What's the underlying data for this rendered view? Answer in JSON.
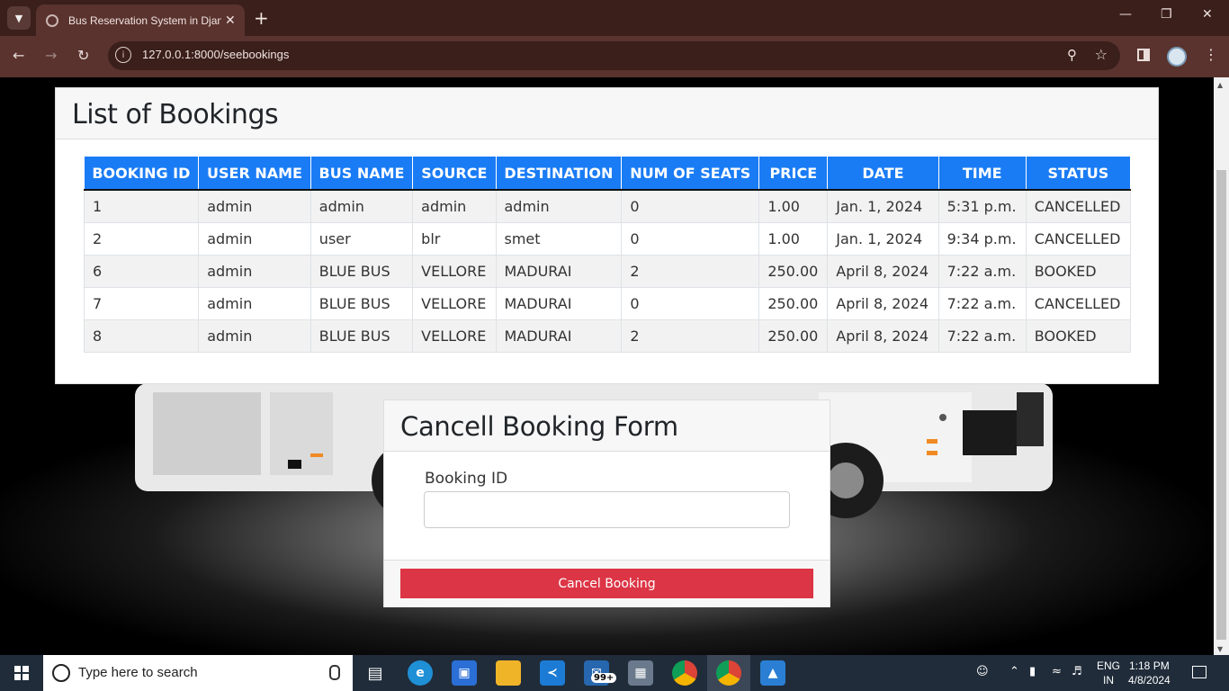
{
  "browser": {
    "tab_title": "Bus Reservation System in Django",
    "url": "127.0.0.1:8000/seebookings",
    "tab_list_icon": "chevron-down-icon",
    "new_tab_icon": "plus-icon"
  },
  "bookings": {
    "title": "List of Bookings",
    "columns": [
      "BOOKING ID",
      "USER NAME",
      "BUS NAME",
      "SOURCE",
      "DESTINATION",
      "NUM OF SEATS",
      "PRICE",
      "DATE",
      "TIME",
      "STATUS"
    ],
    "rows": [
      [
        "1",
        "admin",
        "admin",
        "admin",
        "admin",
        "0",
        "1.00",
        "Jan. 1, 2024",
        "5:31 p.m.",
        "CANCELLED"
      ],
      [
        "2",
        "admin",
        "user",
        "blr",
        "smet",
        "0",
        "1.00",
        "Jan. 1, 2024",
        "9:34 p.m.",
        "CANCELLED"
      ],
      [
        "6",
        "admin",
        "BLUE BUS",
        "VELLORE",
        "MADURAI",
        "2",
        "250.00",
        "April 8, 2024",
        "7:22 a.m.",
        "BOOKED"
      ],
      [
        "7",
        "admin",
        "BLUE BUS",
        "VELLORE",
        "MADURAI",
        "0",
        "250.00",
        "April 8, 2024",
        "7:22 a.m.",
        "CANCELLED"
      ],
      [
        "8",
        "admin",
        "BLUE BUS",
        "VELLORE",
        "MADURAI",
        "2",
        "250.00",
        "April 8, 2024",
        "7:22 a.m.",
        "BOOKED"
      ]
    ]
  },
  "cancel_form": {
    "title": "Cancell Booking Form",
    "field_label": "Booking ID",
    "field_value": "",
    "button_label": "Cancel Booking"
  },
  "taskbar": {
    "search_placeholder": "Type here to search",
    "mail_badge": "99+",
    "language_line1": "ENG",
    "language_line2": "IN",
    "time": "1:18 PM",
    "date": "4/8/2024"
  },
  "colors": {
    "table_header": "#1a7cf5",
    "cancel_button": "#dc3545",
    "browser_frame": "#3a1f1b"
  }
}
